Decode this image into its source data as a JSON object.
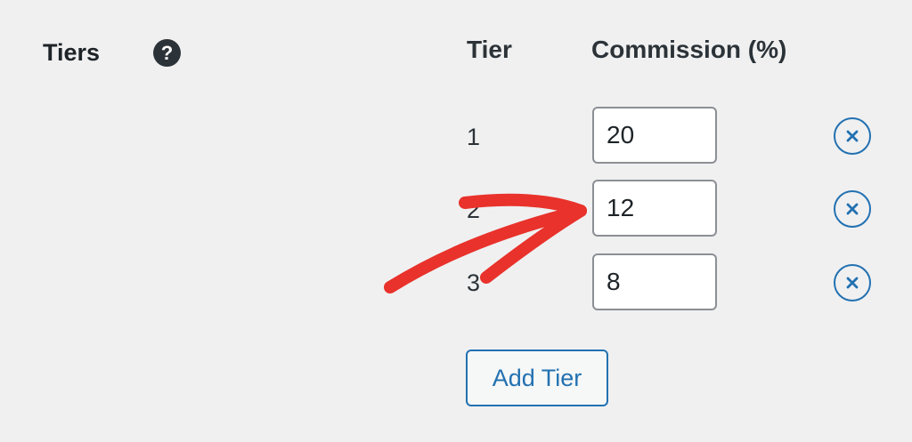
{
  "field": {
    "label": "Tiers",
    "help_icon": "question-mark-icon",
    "help_glyph": "?"
  },
  "table": {
    "headers": [
      "Tier",
      "Commission (%)"
    ],
    "rows": [
      {
        "tier": "1",
        "commission": "20"
      },
      {
        "tier": "2",
        "commission": "12"
      },
      {
        "tier": "3",
        "commission": "8"
      }
    ],
    "remove_icon": "remove-circle-x-icon"
  },
  "add_button": {
    "label": "Add Tier"
  },
  "annotation": {
    "icon": "red-arrow-annotation",
    "color": "#e8322b"
  },
  "colors": {
    "background": "#f0f0f1",
    "accent": "#2271b1",
    "input_border": "#8c8f94",
    "text": "#1d2327"
  }
}
